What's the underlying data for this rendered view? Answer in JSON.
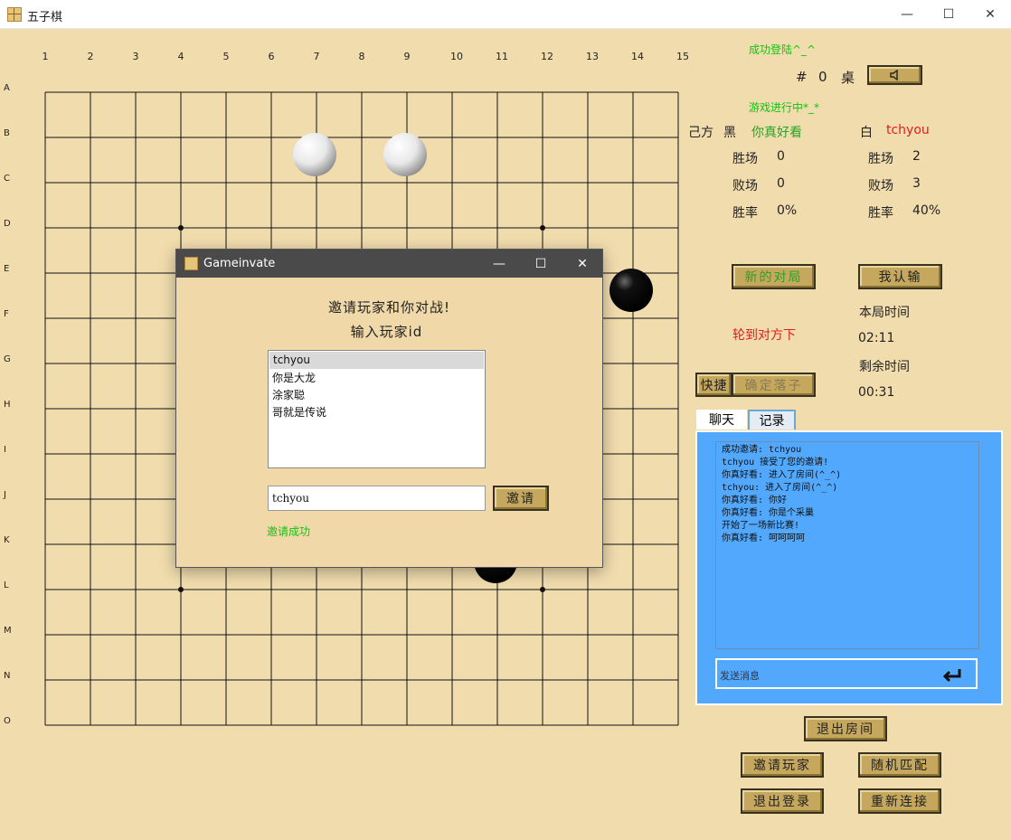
{
  "window": {
    "title": "五子棋",
    "minimize": "—",
    "maximize": "☐",
    "close": "✕"
  },
  "board": {
    "columns": [
      "1",
      "2",
      "3",
      "4",
      "5",
      "6",
      "7",
      "8",
      "9",
      "10",
      "11",
      "12",
      "13",
      "14",
      "15"
    ],
    "rows": [
      "A",
      "B",
      "C",
      "D",
      "E",
      "F",
      "G",
      "H",
      "I",
      "J",
      "K",
      "L",
      "M",
      "N",
      "O"
    ],
    "stones": [
      {
        "color": "white",
        "col": 7,
        "row": "C"
      },
      {
        "color": "white",
        "col": 9,
        "row": "C"
      },
      {
        "color": "black",
        "col": 14,
        "row": "F"
      },
      {
        "color": "black",
        "col": 11,
        "row": "L"
      }
    ]
  },
  "status": {
    "login": "成功登陆^_^",
    "table_label": "#",
    "table_number": "0",
    "table_suffix": "桌",
    "game_state": "游戏进行中*_*",
    "turn": "轮到对方下"
  },
  "players": {
    "self_label": "己方",
    "black": {
      "color_label": "黑",
      "name": "你真好看",
      "wins_label": "胜场",
      "wins": "0",
      "losses_label": "败场",
      "losses": "0",
      "rate_label": "胜率",
      "rate": "0%"
    },
    "white": {
      "color_label": "白",
      "name": "tchyou",
      "wins_label": "胜场",
      "wins": "2",
      "losses_label": "败场",
      "losses": "3",
      "rate_label": "胜率",
      "rate": "40%"
    }
  },
  "timers": {
    "round_label": "本局时间",
    "round_time": "02:11",
    "remain_label": "剩余时间",
    "remain_time": "00:31"
  },
  "buttons": {
    "new_game": "新的对局",
    "surrender": "我认输",
    "quick": "快捷",
    "confirm_move": "确定落子",
    "leave_room": "退出房间",
    "invite_player": "邀请玩家",
    "random_match": "随机匹配",
    "logout": "退出登录",
    "reconnect": "重新连接"
  },
  "chat": {
    "tabs": [
      "聊天",
      "记录"
    ],
    "messages": [
      "成功邀请: tchyou",
      "tchyou 接受了您的邀请!",
      "你真好看: 进入了房间(^_^)",
      "tchyou: 进入了房间(^_^)",
      "你真好看: 你好",
      "你真好看: 你是个采巢",
      "开始了一场新比赛!",
      "你真好看: 呵呵呵呵"
    ],
    "input_placeholder": "发送消息"
  },
  "dialog": {
    "title": "Gameinvate",
    "heading": "邀请玩家和你对战!",
    "subheading": "输入玩家id",
    "players": [
      "tchyou",
      "你是大龙",
      "涂家聪",
      "哥就是传说"
    ],
    "selected_index": 0,
    "input_value": "tchyou",
    "invite_button": "邀请",
    "status": "邀请成功"
  },
  "colors": {
    "background": "#f1dcae",
    "button": "#c5a85e",
    "chat_bg": "#52a8fc",
    "success": "#12c412",
    "alert": "#e41c1c"
  }
}
